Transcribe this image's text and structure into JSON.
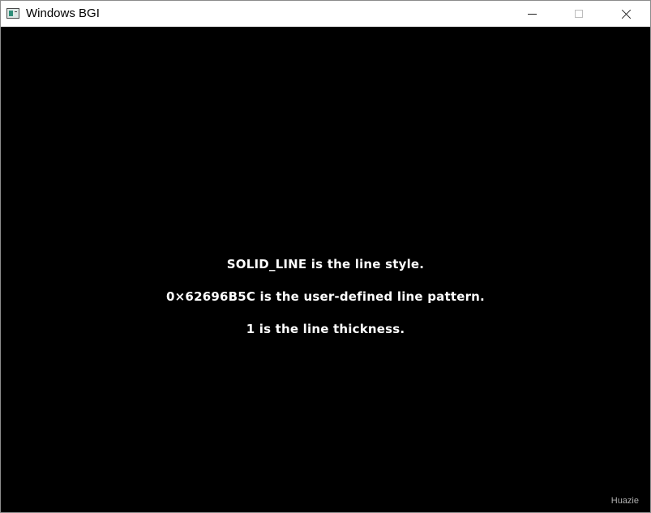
{
  "window": {
    "title": "Windows BGI",
    "icon": "bgi-app-icon",
    "controls": {
      "minimize_icon": "minimize-icon",
      "maximize_icon": "maximize-icon",
      "close_icon": "close-icon"
    }
  },
  "canvas": {
    "background": "#000000",
    "text_color": "#ffffff",
    "lines": [
      "SOLID_LINE is the line style.",
      "0×62696B5C is the user-defined line pattern.",
      "1 is the line thickness."
    ],
    "watermark": "Huazie"
  }
}
